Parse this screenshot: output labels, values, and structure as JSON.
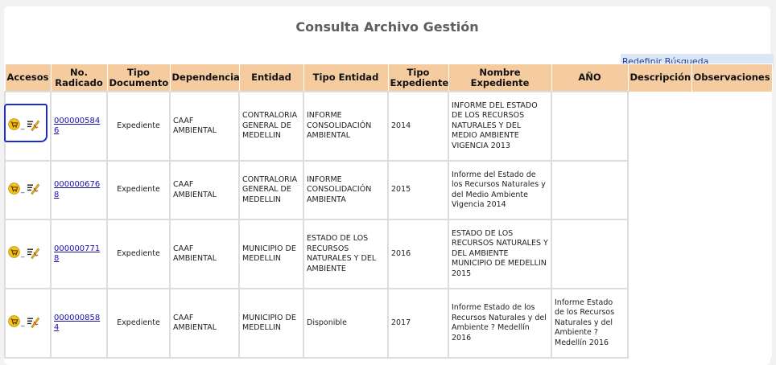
{
  "page": {
    "title": "Consulta Archivo Gestión",
    "redefinir_label": "Redefinir Búsqueda"
  },
  "table": {
    "headers": [
      "Accesos",
      "No. Radicado",
      "Tipo Documento",
      "Dependencia",
      "Entidad",
      "Tipo Entidad",
      "Tipo Expediente",
      "Nombre Expediente",
      "AÑO",
      "Descripción",
      "Observaciones"
    ],
    "access_separator": "_",
    "rows": [
      {
        "radicado": "0000005846",
        "tipo_documento": "Expediente",
        "dependencia": "CAAF AMBIENTAL",
        "entidad": "CONTRALORIA GENERAL DE MEDELLIN",
        "tipo_entidad": "INFORME CONSOLIDACIÓN AMBIENTAL",
        "tipo_expediente": "2014",
        "nombre_expediente": "INFORME DEL ESTADO DE LOS RECURSOS NATURALES Y DEL MEDIO AMBIENTE VIGENCIA 2013",
        "anio": ""
      },
      {
        "radicado": "0000006768",
        "tipo_documento": "Expediente",
        "dependencia": "CAAF AMBIENTAL",
        "entidad": "CONTRALORIA GENERAL DE MEDELLIN",
        "tipo_entidad": "INFORME CONSOLIDACIÓN AMBIENTA",
        "tipo_expediente": "2015",
        "nombre_expediente": "Informe del Estado de los Recursos Naturales y del Medio Ambiente Vigencia 2014",
        "anio": ""
      },
      {
        "radicado": "0000007718",
        "tipo_documento": "Expediente",
        "dependencia": "CAAF AMBIENTAL",
        "entidad": "MUNICIPIO DE MEDELLIN",
        "tipo_entidad": "ESTADO DE LOS RECURSOS NATURALES Y DEL AMBIENTE",
        "tipo_expediente": "2016",
        "nombre_expediente": "ESTADO DE LOS RECURSOS NATURALES Y DEL AMBIENTE MUNICIPIO DE MEDELLIN 2015",
        "anio": ""
      },
      {
        "radicado": "0000008584",
        "tipo_documento": "Expediente",
        "dependencia": "CAAF AMBIENTAL",
        "entidad": "MUNICIPIO DE MEDELLIN",
        "tipo_entidad": "Disponible",
        "tipo_expediente": "2017",
        "nombre_expediente": "Informe Estado de los Recursos Naturales y del Ambiente ? Medellín 2016",
        "anio": "Informe Estado de los Recursos Naturales y del Ambiente ? Medellín 2016"
      }
    ]
  },
  "colors": {
    "header_bg": "#f5cba0",
    "link": "#1a0dab",
    "redefinir_bg": "#dde6f4",
    "annotation": "#1a2ad4"
  },
  "icons": [
    "cart-icon",
    "edit-icon"
  ]
}
